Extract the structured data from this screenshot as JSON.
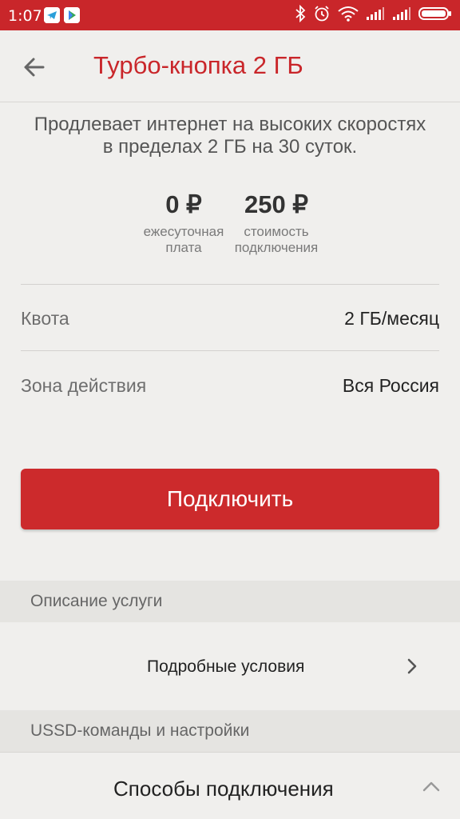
{
  "status_bar": {
    "time": "1:07",
    "icons": [
      "telegram-icon",
      "play-store-icon",
      "bluetooth-icon",
      "alarm-icon",
      "wifi-icon",
      "signal-icon",
      "signal-icon",
      "battery-icon"
    ]
  },
  "header": {
    "title": "Турбо-кнопка 2 ГБ"
  },
  "description": {
    "line1": "Продлевает интернет на высоких скоростях",
    "line2": "в пределах 2 ГБ на 30 суток."
  },
  "prices": {
    "daily": {
      "value": "0 ₽",
      "caption1": "ежесуточная",
      "caption2": "плата"
    },
    "connect": {
      "value": "250 ₽",
      "caption1": "стоимость",
      "caption2": "подключения"
    }
  },
  "details": {
    "quota_label": "Квота",
    "quota_value": "2 ГБ/месяц",
    "zone_label": "Зона действия",
    "zone_value": "Вся Россия"
  },
  "connect_button": "Подключить",
  "sections": {
    "description_title": "Описание услуги",
    "terms_link": "Подробные условия",
    "ussd_title": "USSD-команды и настройки",
    "methods_title": "Способы подключения"
  },
  "colors": {
    "brand": "#c9262a",
    "background": "#f0efed",
    "section_bg": "#e5e4e1"
  }
}
